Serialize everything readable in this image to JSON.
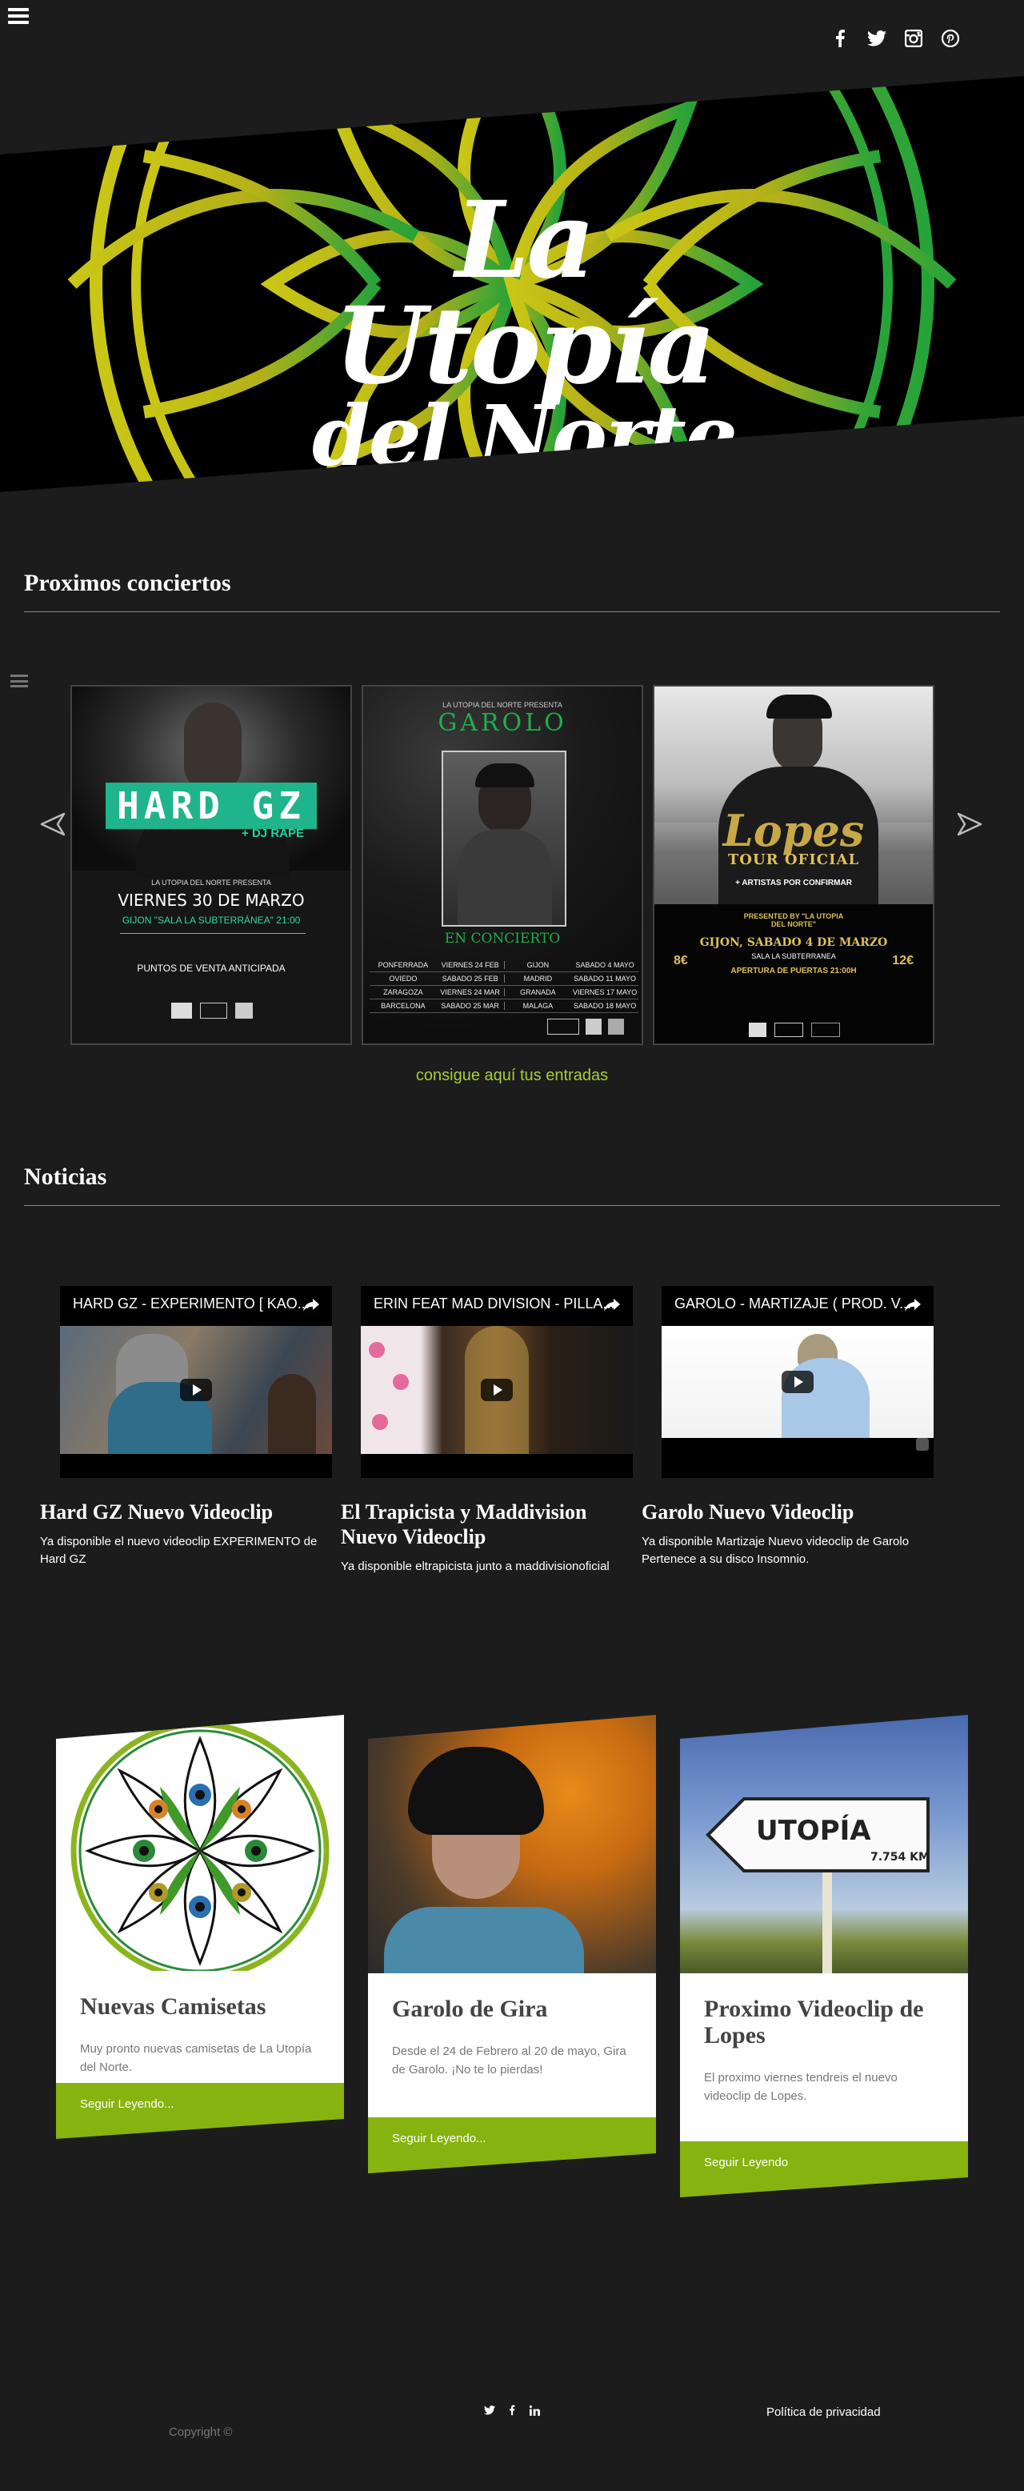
{
  "hero": {
    "title_line1": "La Utopía",
    "title_line2": "del Norte"
  },
  "socials": [
    "facebook-icon",
    "twitter-icon",
    "instagram-icon",
    "pinterest-icon"
  ],
  "concerts": {
    "heading": "Proximos conciertos",
    "tickets_link": "consigue aquí tus entradas",
    "posters": [
      {
        "name": "HARD GZ",
        "tag": "+ DJ RAPE",
        "line": "LA UTOPIA DEL NORTE PRESENTA",
        "date": "VIERNES 30 DE MARZO",
        "venue": "GIJON \"SALA LA SUBTERRÁNEA\" 21:00",
        "sales": "PUNTOS DE VENTA ANTICIPADA"
      },
      {
        "name": "GAROLO",
        "line": "LA UTOPIA DEL NORTE PRESENTA",
        "sub": "EN CONCIERTO",
        "dates": [
          [
            "PONFERRADA",
            "VIERNES 24 FEB",
            "GIJON",
            "SABADO 4 MAYO"
          ],
          [
            "OVIEDO",
            "SABADO 25 FEB",
            "MADRID",
            "SABADO 11 MAYO"
          ],
          [
            "ZARAGOZA",
            "VIERNES 24 MAR",
            "GRANADA",
            "VIERNES 17 MAYO"
          ],
          [
            "BARCELONA",
            "SABADO 25 MAR",
            "MALAGA",
            "SABADO 18 MAYO"
          ]
        ]
      },
      {
        "name": "Lopes",
        "tour": "TOUR OFICIAL",
        "artists": "+ ARTISTAS POR CONFIRMAR",
        "presented": "PRESENTED BY \"LA UTOPIA DEL NORTE\"",
        "date": "GIJON, SABADO 4 DE MARZO",
        "venue": "SALA LA SUBTERRANEA",
        "doors": "APERTURA DE PUERTAS 21:00H",
        "price_left": "8€",
        "price_right": "12€"
      }
    ]
  },
  "news": {
    "heading": "Noticias",
    "videos": [
      {
        "title": "HARD GZ - EXPERIMENTO [ KAO...",
        "heading": "Hard GZ Nuevo Videoclip",
        "text": "Ya disponible el nuevo videoclip EXPERIMENTO de Hard GZ"
      },
      {
        "title": "ERIN FEAT MAD DIVISION - PILLA...",
        "heading": "El Trapicista y Maddivision Nuevo Videoclip",
        "text": "Ya disponible eltrapicista junto a maddivisionoficial"
      },
      {
        "title": "GAROLO - MARTIZAJE ( PROD. V...",
        "heading": "Garolo Nuevo Videoclip",
        "text": "Ya disponible Martizaje Nuevo videoclip de Garolo Pertenece a su disco Insomnio."
      }
    ]
  },
  "cards": [
    {
      "title": "Nuevas Camisetas",
      "text": "Muy pronto nuevas camisetas de La Utopía del Norte.",
      "button": "Seguir Leyendo..."
    },
    {
      "title": "Garolo de Gira",
      "text": "Desde el 24 de Febrero al 20 de mayo, Gira de Garolo. ¡No te lo pierdas!",
      "button": "Seguir Leyendo..."
    },
    {
      "title": "Proximo Videoclip de Lopes",
      "text": "El proximo viernes tendreis el nuevo videoclip de Lopes.",
      "button": "Seguir Leyendo"
    }
  ],
  "sign": {
    "text": "UTOPÍA",
    "km": "7.754 KM"
  },
  "footer": {
    "copyright": "Copyright ©",
    "privacy": "Política de privacidad",
    "icons": [
      "twitter-icon",
      "facebook-icon",
      "linkedin-icon"
    ]
  },
  "colors": {
    "accent": "#86b30f",
    "link": "#a6ce39",
    "background": "#1c1c1c"
  }
}
